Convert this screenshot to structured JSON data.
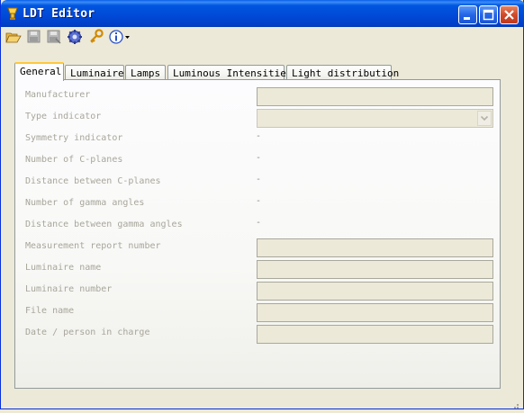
{
  "window": {
    "title": "LDT Editor"
  },
  "toolbar": {
    "items": [
      {
        "name": "open-icon"
      },
      {
        "name": "save-icon"
      },
      {
        "name": "save-as-icon"
      },
      {
        "name": "settings-gear-icon"
      },
      {
        "name": "key-icon"
      },
      {
        "name": "info-icon"
      }
    ]
  },
  "tabs": [
    {
      "label": "General",
      "active": true
    },
    {
      "label": "Luminaire",
      "active": false
    },
    {
      "label": "Lamps",
      "active": false
    },
    {
      "label": "Luminous Intensities",
      "active": false
    },
    {
      "label": "Light distribution",
      "active": false
    }
  ],
  "general": {
    "manufacturer_label": "Manufacturer",
    "manufacturer_value": "",
    "type_indicator_label": "Type indicator",
    "type_indicator_value": "",
    "symmetry_indicator_label": "Symmetry indicator",
    "symmetry_indicator_value": "-",
    "number_c_planes_label": "Number of C-planes",
    "number_c_planes_value": "-",
    "distance_c_planes_label": "Distance between C-planes",
    "distance_c_planes_value": "-",
    "number_gamma_label": "Number of gamma angles",
    "number_gamma_value": "-",
    "distance_gamma_label": "Distance between gamma angles",
    "distance_gamma_value": "-",
    "measurement_report_label": "Measurement report number",
    "measurement_report_value": "",
    "luminaire_name_label": "Luminaire name",
    "luminaire_name_value": "",
    "luminaire_number_label": "Luminaire number",
    "luminaire_number_value": "",
    "file_name_label": "File name",
    "file_name_value": "",
    "date_person_label": "Date / person in charge",
    "date_person_value": ""
  }
}
